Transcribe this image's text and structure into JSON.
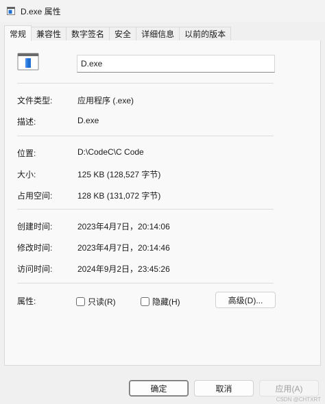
{
  "window": {
    "title": "D.exe 属性",
    "icon": "window-file-icon"
  },
  "tabs": [
    {
      "label": "常规",
      "active": true
    },
    {
      "label": "兼容性",
      "active": false
    },
    {
      "label": "数字签名",
      "active": false
    },
    {
      "label": "安全",
      "active": false
    },
    {
      "label": "详细信息",
      "active": false
    },
    {
      "label": "以前的版本",
      "active": false
    }
  ],
  "general": {
    "file_icon": "exe-file-icon",
    "file_name": "D.exe",
    "type": {
      "label": "文件类型:",
      "value": "应用程序 (.exe)"
    },
    "description": {
      "label": "描述:",
      "value": "D.exe"
    },
    "location": {
      "label": "位置:",
      "value": "D:\\CodeC\\C Code"
    },
    "size": {
      "label": "大小:",
      "value": "125 KB (128,527 字节)"
    },
    "size_on_disk": {
      "label": "占用空间:",
      "value": "128 KB (131,072 字节)"
    },
    "created": {
      "label": "创建时间:",
      "value": "2023年4月7日，20:14:06"
    },
    "modified": {
      "label": "修改时间:",
      "value": "2023年4月7日，20:14:46"
    },
    "accessed": {
      "label": "访问时间:",
      "value": "2024年9月2日，23:45:26"
    },
    "attributes": {
      "label": "属性:",
      "readonly_label": "只读(R)",
      "readonly_checked": false,
      "hidden_label": "隐藏(H)",
      "hidden_checked": false,
      "advanced_label": "高级(D)..."
    }
  },
  "buttons": {
    "ok": "确定",
    "cancel": "取消",
    "apply": "应用(A)"
  },
  "watermark": "CSDN @CHTXRT",
  "colors": {
    "icon_blue": "#1f6fd1",
    "window_bg": "#f0f0f0",
    "panel_bg": "#f9f9f9"
  }
}
